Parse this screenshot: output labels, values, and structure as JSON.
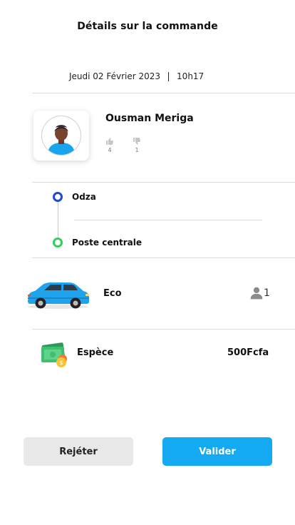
{
  "header": {
    "title": "Détails sur la commande"
  },
  "order": {
    "date": "Jeudi 02 Février 2023",
    "time": "10h17"
  },
  "driver": {
    "name": "Ousman Meriga",
    "likes": "4",
    "dislikes": "1"
  },
  "route": {
    "from": "Odza",
    "to": "Poste centrale"
  },
  "vehicle": {
    "type": "Eco",
    "seats": "1"
  },
  "payment": {
    "method": "Espèce",
    "price": "500Fcfa"
  },
  "actions": {
    "reject_label": "Rejéter",
    "accept_label": "Valider"
  },
  "colors": {
    "accent": "#14aaf1",
    "route_start": "#1f47d8",
    "route_end": "#2ed158",
    "reject_bg": "#e8e8e8"
  },
  "icons": {
    "like": "thumbs-up-icon",
    "dislike": "thumbs-down-icon",
    "seats": "person-icon",
    "vehicle": "car-icon",
    "payment": "cash-icon"
  }
}
